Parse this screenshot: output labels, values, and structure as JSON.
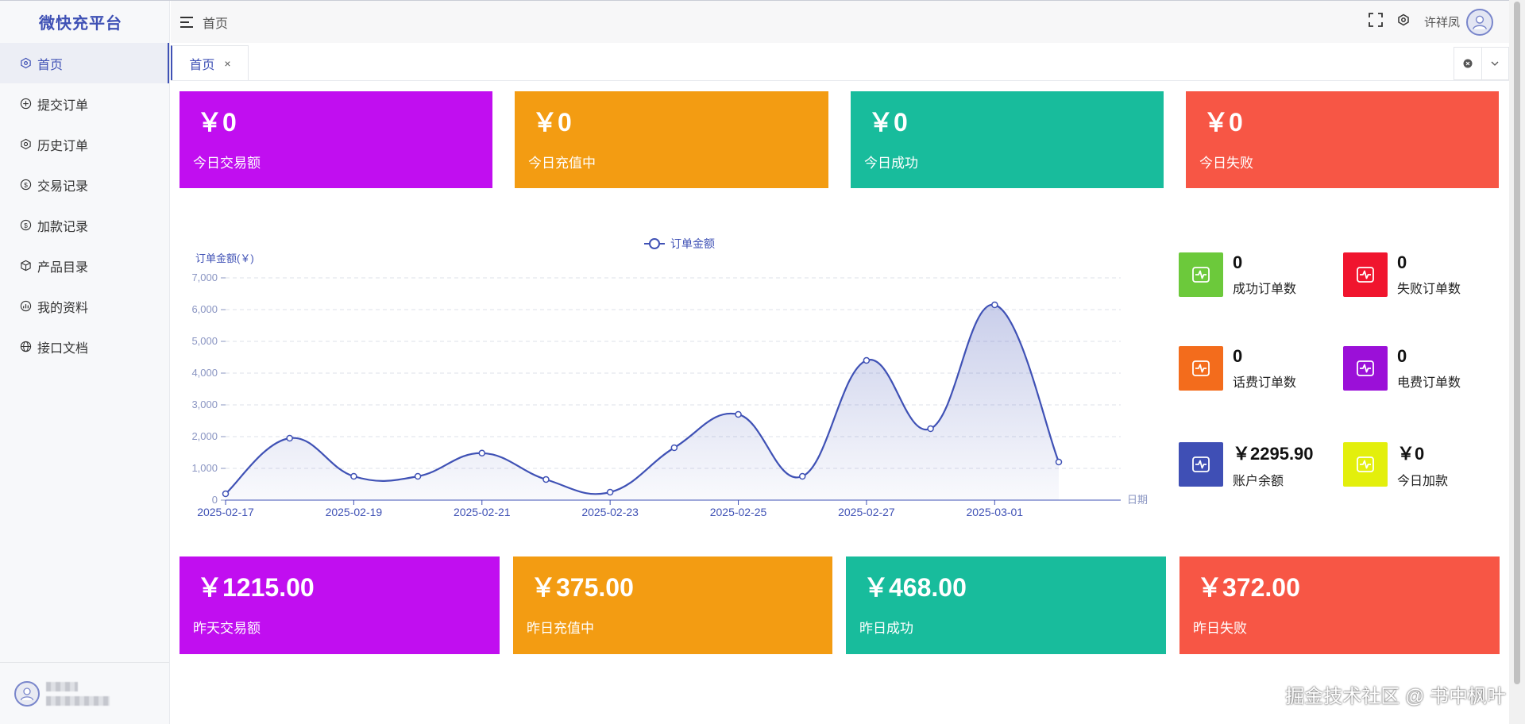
{
  "app": {
    "brand": "微快充平台"
  },
  "header": {
    "breadcrumb": "首页",
    "username": "许祥凤"
  },
  "sidebar": {
    "items": [
      {
        "label": "首页",
        "icon": "home-icon"
      },
      {
        "label": "提交订单",
        "icon": "plus-circle-icon"
      },
      {
        "label": "历史订单",
        "icon": "gear-icon"
      },
      {
        "label": "交易记录",
        "icon": "dollar-circle-icon"
      },
      {
        "label": "加款记录",
        "icon": "dollar-circle-icon"
      },
      {
        "label": "产品目录",
        "icon": "cube-icon"
      },
      {
        "label": "我的资料",
        "icon": "chart-icon"
      },
      {
        "label": "接口文档",
        "icon": "globe-icon"
      }
    ]
  },
  "tabs": [
    {
      "label": "首页",
      "close": "×"
    }
  ],
  "today_cards": [
    {
      "amount": "￥0",
      "label": "今日交易额",
      "color": "#c10ef0"
    },
    {
      "amount": "￥0",
      "label": "今日充值中",
      "color": "#f39c12"
    },
    {
      "amount": "￥0",
      "label": "今日成功",
      "color": "#18bc9c"
    },
    {
      "amount": "￥0",
      "label": "今日失败",
      "color": "#f75645"
    }
  ],
  "yesterday_cards": [
    {
      "amount": "￥1215.00",
      "label": "昨天交易额",
      "color": "#c10ef0"
    },
    {
      "amount": "￥375.00",
      "label": "昨日充值中",
      "color": "#f39c12"
    },
    {
      "amount": "￥468.00",
      "label": "昨日成功",
      "color": "#18bc9c"
    },
    {
      "amount": "￥372.00",
      "label": "昨日失败",
      "color": "#f75645"
    }
  ],
  "mini_stats": [
    {
      "value": "0",
      "label": "成功订单数",
      "color": "#6cc93b",
      "icon": "pulse-icon"
    },
    {
      "value": "0",
      "label": "失败订单数",
      "color": "#f0152e",
      "icon": "pulse-icon"
    },
    {
      "value": "0",
      "label": "话费订单数",
      "color": "#f36c1c",
      "icon": "pulse-icon"
    },
    {
      "value": "0",
      "label": "电费订单数",
      "color": "#9b10d8",
      "icon": "pulse-icon"
    },
    {
      "value": "￥2295.90",
      "label": "账户余额",
      "color": "#3f4fb5",
      "icon": "pulse-icon"
    },
    {
      "value": "￥0",
      "label": "今日加款",
      "color": "#e3ef0c",
      "icon": "pulse-icon"
    }
  ],
  "chart_data": {
    "type": "line",
    "smooth": true,
    "area": true,
    "legend": "订单金额",
    "legend_position": "top-center",
    "ylabel": "订单金额(￥)",
    "xlabel": "日期",
    "ylim": [
      0,
      7000
    ],
    "yticks": [
      "0",
      "1,000",
      "2,000",
      "3,000",
      "4,000",
      "5,000",
      "6,000",
      "7,000"
    ],
    "x": [
      "2025-02-17",
      "2025-02-18",
      "2025-02-19",
      "2025-02-20",
      "2025-02-21",
      "2025-02-22",
      "2025-02-23",
      "2025-02-24",
      "2025-02-25",
      "2025-02-26",
      "2025-02-27",
      "2025-02-28",
      "2025-03-01",
      "2025-03-02"
    ],
    "xtick_labels": [
      "2025-02-17",
      "2025-02-19",
      "2025-02-21",
      "2025-02-23",
      "2025-02-25",
      "2025-02-27",
      "2025-03-01"
    ],
    "values": [
      200,
      1950,
      750,
      750,
      1480,
      650,
      250,
      1650,
      2700,
      750,
      4400,
      2250,
      6150,
      1200
    ],
    "grid": true,
    "color": "#3f51b5"
  },
  "watermark": "掘金技术社区 @ 书中枫叶"
}
